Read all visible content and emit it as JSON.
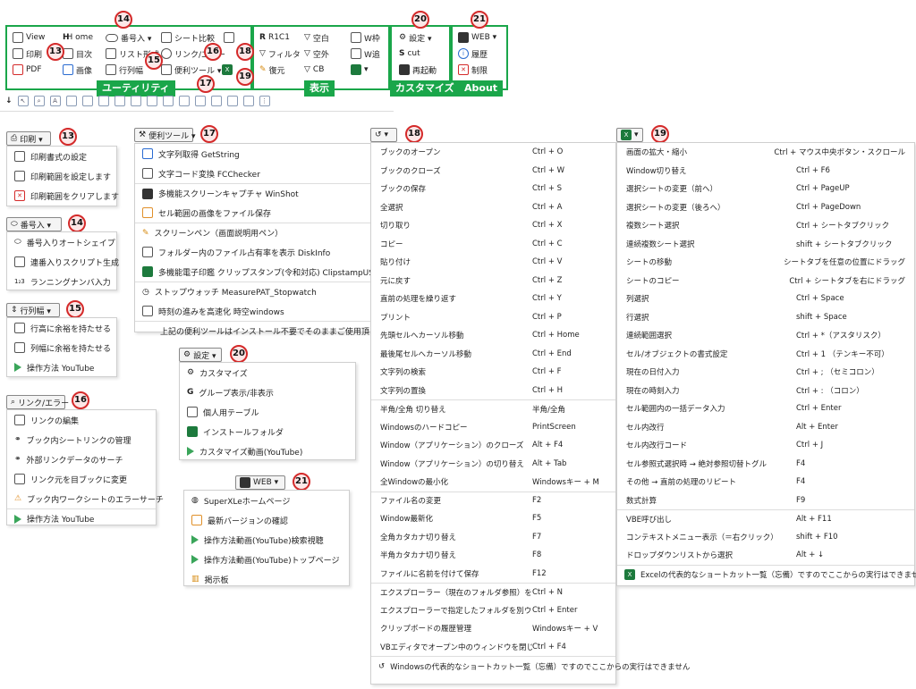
{
  "ribbon": {
    "col1": [
      "View",
      "H ome",
      "番号入 ▾",
      "印刷",
      "目次",
      "リスト形式",
      "PDF",
      "画像",
      "行列幅"
    ],
    "col2": [
      "シート比較",
      "リンク/エラー",
      "便利ツール ▾"
    ],
    "col3": [
      "R1C1",
      "空白",
      "W枠",
      "フィルタ",
      "空外",
      "W追",
      "復元",
      "CB"
    ],
    "col4": [
      "設定 ▾",
      "cut",
      "再起動"
    ],
    "col5": [
      "WEB ▾",
      "履歴",
      "制限"
    ],
    "tags": {
      "utility": "ユーティリティ",
      "display": "表示",
      "customize": "カスタマイズ",
      "about": "About"
    },
    "nums": {
      "n14": "14",
      "n13": "13",
      "n15": "15",
      "n16": "16",
      "n17": "17",
      "n18": "18",
      "n19": "19",
      "n20": "20",
      "n21": "21"
    }
  },
  "print_menu": {
    "button": "印刷 ▾",
    "num": "13",
    "items": [
      "印刷書式の設定",
      "印刷範囲を設定します",
      "印刷範囲をクリアします"
    ]
  },
  "number_menu": {
    "button": "番号入 ▾",
    "num": "14",
    "items": [
      "番号入りオートシェイプ",
      "連番入りスクリプト生成",
      "ランニングナンバ入力"
    ]
  },
  "colrow_menu": {
    "button": "行列幅 ▾",
    "num": "15",
    "items": [
      "行高に余裕を持たせる",
      "列幅に余裕を持たせる",
      "操作方法 YouTube"
    ]
  },
  "link_menu": {
    "button": "リンク/エラー ▾",
    "num": "16",
    "items": [
      "リンクの編集",
      "ブック内シートリンクの管理",
      "外部リンクデータのサーチ",
      "リンク元を目ブックに変更",
      "ブック内ワークシートのエラーサーチ",
      "操作方法 YouTube"
    ]
  },
  "tools_menu": {
    "button": "便利ツール ▾",
    "num": "17",
    "items": [
      "文字列取得 GetString",
      "文字コード変換 FCChecker",
      "多機能スクリーンキャプチャ WinShot",
      "セル範囲の画像をファイル保存",
      "スクリーンペン（画面説明用ペン）",
      "フォルダー内のファイル占有率を表示 DiskInfo",
      "多機能電子印鑑 クリップスタンプ(令和対応) ClipstampUSB",
      "ストップウォッチ MeasurePAT_Stopwatch",
      "時刻の進みを高速化 時空windows",
      "上記の便利ツールはインストール不要でそのままご使用頂けます"
    ]
  },
  "settings_menu": {
    "button": "設定 ▾",
    "num": "20",
    "items": [
      "カスタマイズ",
      "グループ表示/非表示",
      "個人用テーブル",
      "インストールフォルダ",
      "カスタマイズ動画(YouTube)"
    ]
  },
  "web_menu": {
    "button": "WEB ▾",
    "num": "21",
    "items": [
      "SuperXLeホームページ",
      "最新バージョンの確認",
      "操作方法動画(YouTube)検索視聴",
      "操作方法動画(YouTube)トップページ",
      "掲示板"
    ]
  },
  "win_menu": {
    "num": "18",
    "rows": [
      [
        "ブックのオープン",
        "Ctrl + O"
      ],
      [
        "ブックのクローズ",
        "Ctrl + W"
      ],
      [
        "ブックの保存",
        "Ctrl + S"
      ],
      [
        "全選択",
        "Ctrl + A"
      ],
      [
        "切り取り",
        "Ctrl + X"
      ],
      [
        "コピー",
        "Ctrl + C"
      ],
      [
        "貼り付け",
        "Ctrl + V"
      ],
      [
        "元に戻す",
        "Ctrl + Z"
      ],
      [
        "直前の処理を繰り返す",
        "Ctrl + Y"
      ],
      [
        "プリント",
        "Ctrl + P"
      ],
      [
        "先頭セルへカーソル移動",
        "Ctrl + Home"
      ],
      [
        "最後尾セルへカーソル移動",
        "Ctrl + End"
      ],
      [
        "文字列の検索",
        "Ctrl + F"
      ],
      [
        "文字列の置換",
        "Ctrl + H"
      ],
      [
        "半角/全角 切り替え",
        "半角/全角"
      ],
      [
        "Windowsのハードコピー",
        "PrintScreen"
      ],
      [
        "Window（アプリケーション）のクローズ",
        "Alt + F4"
      ],
      [
        "Window（アプリケーション）の切り替え",
        "Alt + Tab"
      ],
      [
        "全Windowの最小化",
        "Windowsキー + M"
      ],
      [
        "ファイル名の変更",
        "F2"
      ],
      [
        "Window最新化",
        "F5"
      ],
      [
        "全角カタカナ切り替え",
        "F7"
      ],
      [
        "半角カタカナ切り替え",
        "F8"
      ],
      [
        "ファイルに名前を付けて保存",
        "F12"
      ],
      [
        "エクスプローラー（現在のフォルダ参照）を複製",
        "Ctrl + N"
      ],
      [
        "エクスプローラーで指定したフォルダを別ウィンドウで開く",
        "Ctrl + Enter"
      ],
      [
        "クリップボードの履歴管理",
        "Windowsキー + V"
      ],
      [
        "VBエディタでオープン中のウィンドウを閉じる",
        "Ctrl + F4"
      ]
    ],
    "footer": "Windowsの代表的なショートカット一覧（忘備）ですのでここからの実行はできません"
  },
  "excel_menu": {
    "num": "19",
    "rows": [
      [
        "画面の拡大・縮小",
        "Ctrl + マウス中央ボタン・スクロール"
      ],
      [
        "Window切り替え",
        "Ctrl + F6"
      ],
      [
        "選択シートの変更（前へ）",
        "Ctrl + PageUP"
      ],
      [
        "選択シートの変更（後ろへ）",
        "Ctrl + PageDown"
      ],
      [
        "複数シート選択",
        "Ctrl + シートタブクリック"
      ],
      [
        "連続複数シート選択",
        "shift + シートタブクリック"
      ],
      [
        "シートの移動",
        "シートタブを任意の位置にドラッグ"
      ],
      [
        "シートのコピー",
        "Ctrl + シートタブを右にドラッグ"
      ],
      [
        "列選択",
        "Ctrl + Space"
      ],
      [
        "行選択",
        "shift + Space"
      ],
      [
        "連続範囲選択",
        "Ctrl + *（アスタリスク）"
      ],
      [
        "セル/オブジェクトの書式設定",
        "Ctrl + 1 （テンキー不可）"
      ],
      [
        "現在の日付入力",
        "Ctrl + ; （セミコロン）"
      ],
      [
        "現在の時刻入力",
        "Ctrl + : （コロン）"
      ],
      [
        "セル範囲内の一括データ入力",
        "Ctrl + Enter"
      ],
      [
        "セル内改行",
        "Alt + Enter"
      ],
      [
        "セル内改行コード",
        "Ctrl + J"
      ],
      [
        "セル参照式選択時 → 絶対参照切替トグル",
        "F4"
      ],
      [
        "その他 → 直前の処理のリピート",
        "F4"
      ],
      [
        "数式計算",
        "F9"
      ],
      [
        "VBE呼び出し",
        "Alt + F11"
      ],
      [
        "コンテキストメニュー表示（＝右クリック）",
        "shift + F10"
      ],
      [
        "ドロップダウンリストから選択",
        "Alt + ↓"
      ]
    ],
    "footer": "Excelの代表的なショートカット一覧（忘備）ですのでここからの実行はできません"
  }
}
